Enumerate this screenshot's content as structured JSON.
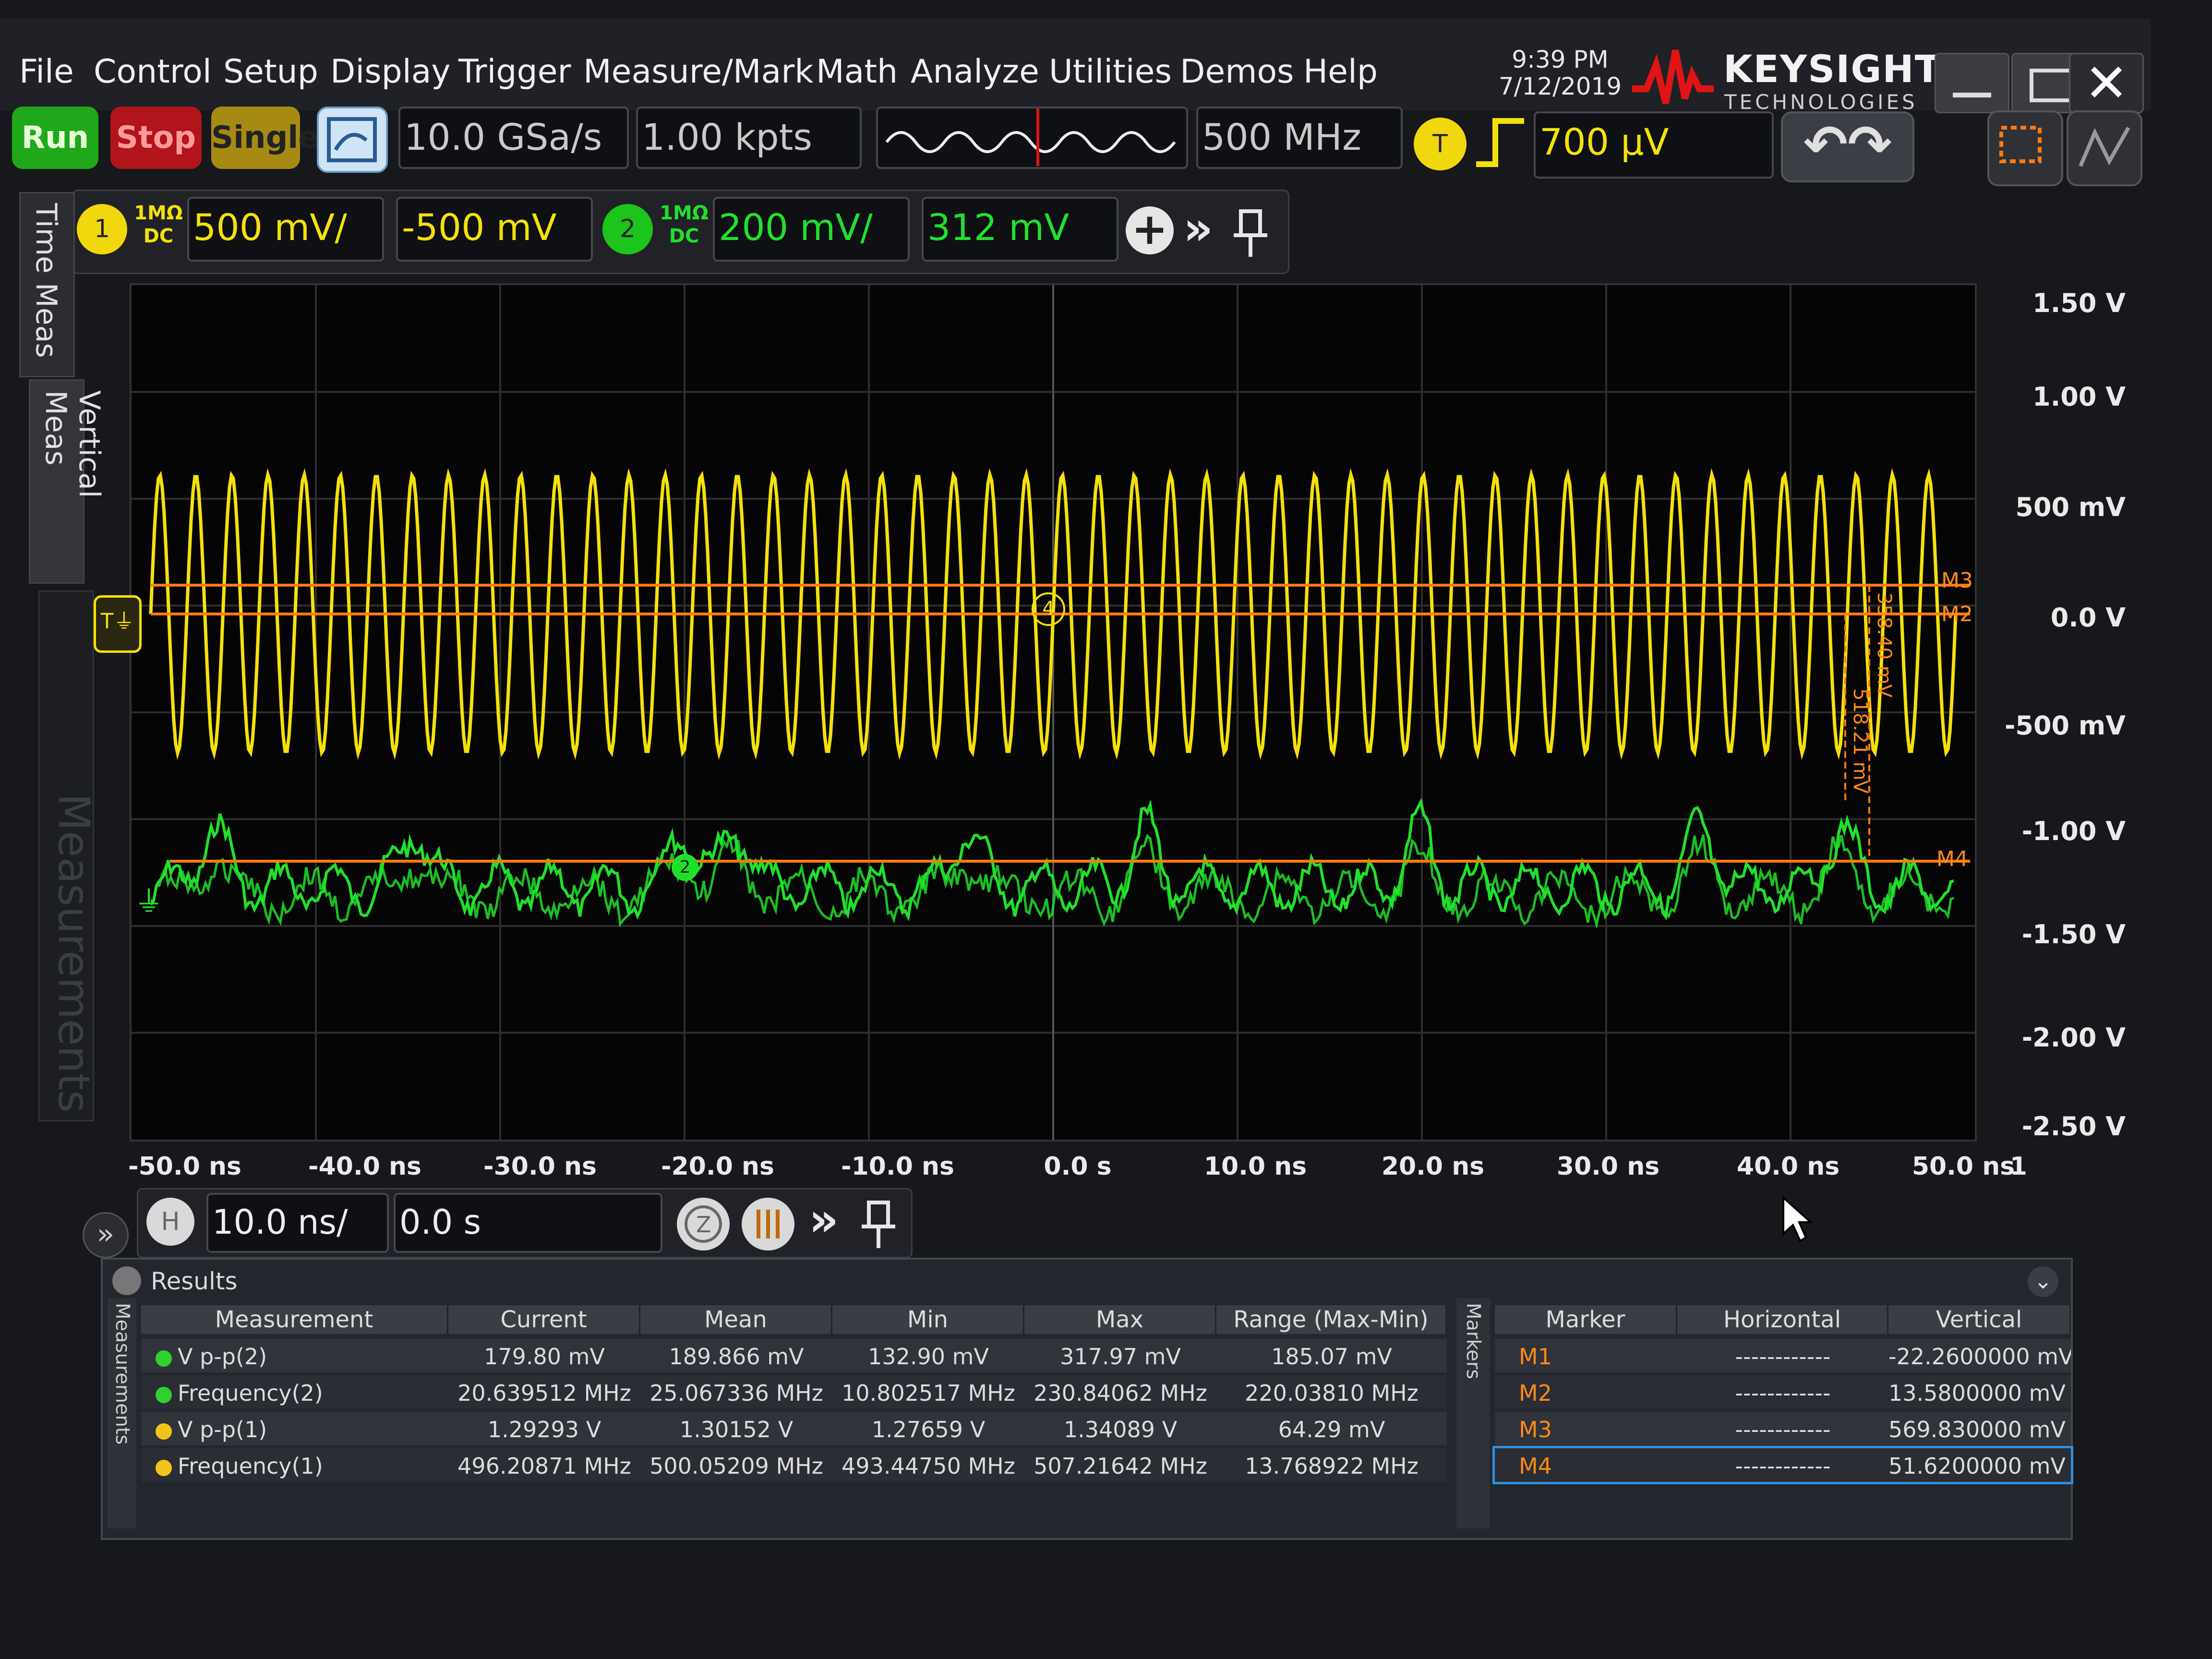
{
  "menu": [
    "File",
    "Control",
    "Setup",
    "Display",
    "Trigger",
    "Measure/Mark",
    "Math",
    "Analyze",
    "Utilities",
    "Demos",
    "Help"
  ],
  "clock": {
    "time": "9:39 PM",
    "date": "7/12/2019"
  },
  "brand": {
    "name": "KEYSIGHT",
    "sub": "TECHNOLOGIES"
  },
  "acq": {
    "run": "Run",
    "stop": "Stop",
    "single": "Single",
    "sample_rate": "10.0 GSa/s",
    "points": "1.00 kpts",
    "bandwidth": "500 MHz"
  },
  "trigger": {
    "label": "T",
    "level": "700 µV"
  },
  "channels": [
    {
      "num": "1",
      "imp": "1MΩ",
      "coupling": "DC",
      "scale": "500 mV/",
      "offset": "-500 mV"
    },
    {
      "num": "2",
      "imp": "1MΩ",
      "coupling": "DC",
      "scale": "200 mV/",
      "offset": "312 mV"
    }
  ],
  "side_tabs": [
    "Time Meas",
    "Vertical Meas",
    "Measurements"
  ],
  "y_axis": [
    "1.50 V",
    "1.00 V",
    "500 mV",
    "0.0 V",
    "-500 mV",
    "-1.00 V",
    "-1.50 V",
    "-2.00 V",
    "-2.50 V"
  ],
  "x_axis": [
    "-50.0 ns",
    "-40.0 ns",
    "-30.0 ns",
    "-20.0 ns",
    "-10.0 ns",
    "0.0 s",
    "10.0 ns",
    "20.0 ns",
    "30.0 ns",
    "40.0 ns",
    "50.0 ns"
  ],
  "x_axis_end": "1",
  "markers_on_screen": {
    "m3": "M3",
    "m2": "M2",
    "m4": "M4",
    "delta1": "358.40 mV",
    "delta2": "518.21 mV",
    "trig_badge": "4",
    "ch2_badge": "2"
  },
  "horizontal": {
    "label": "H",
    "scale": "10.0 ns/",
    "position": "0.0 s"
  },
  "results": {
    "title": "Results",
    "side_label": "Measurements",
    "markers_side_label": "Markers",
    "headers": [
      "Measurement",
      "Current",
      "Mean",
      "Min",
      "Max",
      "Range (Max-Min)"
    ],
    "rows": [
      {
        "name": "V p-p(2)",
        "color": "#2fd12f",
        "current": "179.80 mV",
        "mean": "189.866 mV",
        "min": "132.90 mV",
        "max": "317.97 mV",
        "range": "185.07 mV"
      },
      {
        "name": "Frequency(2)",
        "color": "#2fd12f",
        "current": "20.639512 MHz",
        "mean": "25.067336 MHz",
        "min": "10.802517 MHz",
        "max": "230.84062 MHz",
        "range": "220.03810 MHz"
      },
      {
        "name": "V p-p(1)",
        "color": "#f0c41a",
        "current": "1.29293 V",
        "mean": "1.30152 V",
        "min": "1.27659 V",
        "max": "1.34089 V",
        "range": "64.29 mV"
      },
      {
        "name": "Frequency(1)",
        "color": "#f0c41a",
        "current": "496.20871 MHz",
        "mean": "500.05209 MHz",
        "min": "493.44750 MHz",
        "max": "507.21642 MHz",
        "range": "13.768922 MHz"
      }
    ],
    "marker_headers": [
      "Marker",
      "Horizontal",
      "Vertical"
    ],
    "markers": [
      {
        "name": "M1",
        "horizontal": "------------",
        "vertical": "-22.2600000 mV"
      },
      {
        "name": "M2",
        "horizontal": "------------",
        "vertical": "13.5800000 mV"
      },
      {
        "name": "M3",
        "horizontal": "------------",
        "vertical": "569.830000 mV"
      },
      {
        "name": "M4",
        "horizontal": "------------",
        "vertical": "51.6200000 mV"
      }
    ]
  },
  "colors": {
    "ch1": "#f4e10a",
    "ch2": "#21e02c",
    "marker": "#ff7a10"
  }
}
